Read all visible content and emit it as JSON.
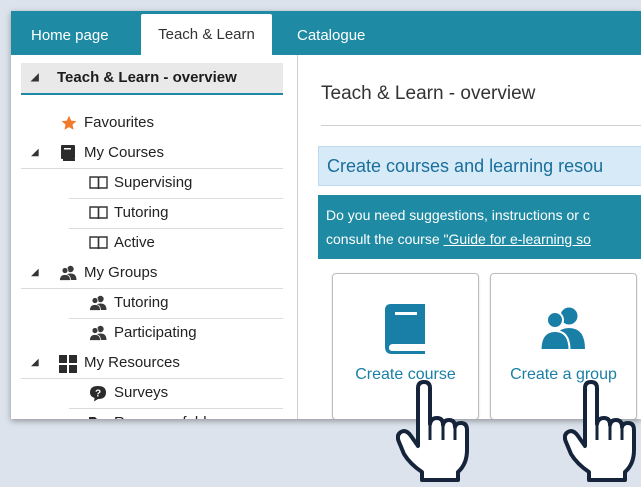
{
  "nav": {
    "tabs": [
      {
        "label": "Home page"
      },
      {
        "label": "Teach & Learn"
      },
      {
        "label": "Catalogue"
      }
    ]
  },
  "sidebar": {
    "overview": "Teach & Learn - overview",
    "favourites": "Favourites",
    "my_courses": "My Courses",
    "supervising": "Supervising",
    "tutoring_course": "Tutoring",
    "active": "Active",
    "my_groups": "My Groups",
    "tutoring_group": "Tutoring",
    "participating": "Participating",
    "my_resources": "My Resources",
    "surveys": "Surveys",
    "resource_folder": "Resource folder"
  },
  "content": {
    "title": "Teach & Learn - overview",
    "create_banner": "Create courses and learning resou",
    "info_line1": "Do you need suggestions, instructions or c",
    "info_line2_prefix": "consult the course ",
    "info_link": "\"Guide for e-learning so",
    "cards": {
      "course": "Create course",
      "group": "Create a group"
    }
  },
  "colors": {
    "accent": "#1e8aa3",
    "banner_bg": "#d6eaf8",
    "link": "#1a7fa6",
    "star": "#f07b2c"
  },
  "icons": [
    "collapse-triangle-icon",
    "star-icon",
    "book-icon",
    "open-book-icon",
    "group-icon",
    "grid-icon",
    "question-bubble-icon",
    "folder-icon",
    "pointing-hand-icon"
  ]
}
